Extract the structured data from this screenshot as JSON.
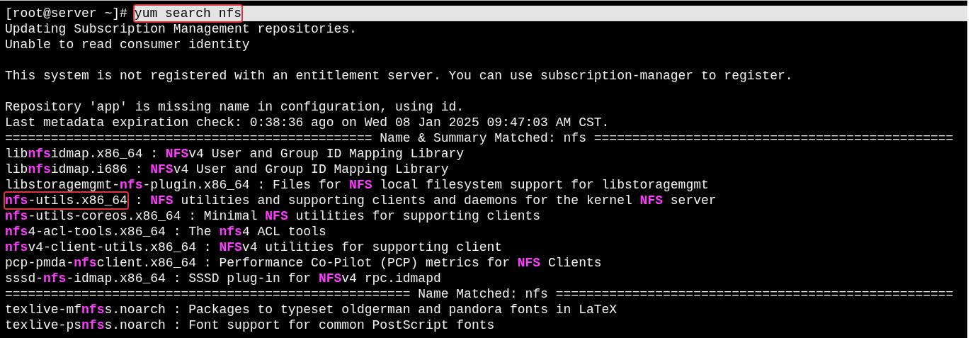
{
  "terminal": {
    "lines": [
      {
        "kind": "prompt",
        "prompt": "[root@server ~]#",
        "command": "yum search nfs",
        "boxed": true
      },
      {
        "kind": "text",
        "text": "Updating Subscription Management repositories."
      },
      {
        "kind": "text",
        "text": "Unable to read consumer identity"
      },
      {
        "kind": "blank"
      },
      {
        "kind": "text",
        "text": "This system is not registered with an entitlement server. You can use subscription-manager to register."
      },
      {
        "kind": "blank"
      },
      {
        "kind": "text",
        "text": "Repository 'app' is missing name in configuration, using id."
      },
      {
        "kind": "text",
        "text": "Last metadata expiration check: 0:38:36 ago on Wed 08 Jan 2025 09:47:03 AM CST."
      },
      {
        "kind": "text",
        "text": "================================================ Name & Summary Matched: nfs ==============================================="
      },
      {
        "kind": "package",
        "name": "lib**nfs**idmap.x86_64",
        "summary": " : **NFS**v4 User and Group ID Mapping Library",
        "boxed": false
      },
      {
        "kind": "package",
        "name": "lib**nfs**idmap.i686",
        "summary": " : **NFS**v4 User and Group ID Mapping Library",
        "boxed": false
      },
      {
        "kind": "package",
        "name": "libstoragemgmt-**nfs**-plugin.x86_64",
        "summary": " : Files for **NFS** local filesystem support for libstoragemgmt",
        "boxed": false
      },
      {
        "kind": "package",
        "name": "**nfs**-utils.x86_64",
        "summary": " : **NFS** utilities and supporting clients and daemons for the kernel **NFS** server",
        "boxed": true
      },
      {
        "kind": "package",
        "name": "**nfs**-utils-coreos.x86_64",
        "summary": " : Minimal **NFS** utilities for supporting clients",
        "boxed": false
      },
      {
        "kind": "package",
        "name": "**nfs**4-acl-tools.x86_64",
        "summary": " : The **nfs**4 ACL tools",
        "boxed": false
      },
      {
        "kind": "package",
        "name": "**nfs**v4-client-utils.x86_64",
        "summary": " : **NFS**v4 utilities for supporting client",
        "boxed": false
      },
      {
        "kind": "package",
        "name": "pcp-pmda-**nfs**client.x86_64",
        "summary": " : Performance Co-Pilot (PCP) metrics for **NFS** Clients",
        "boxed": false
      },
      {
        "kind": "package",
        "name": "sssd-**nfs**-idmap.x86_64",
        "summary": " : SSSD plug-in for **NFS**v4 rpc.idmapd",
        "boxed": false
      },
      {
        "kind": "text",
        "text": "===================================================== Name Matched: nfs ===================================================="
      },
      {
        "kind": "package",
        "name": "texlive-mf**nfs**s.noarch",
        "summary": " : Packages to typeset oldgerman and pandora fonts in LaTeX",
        "boxed": false
      },
      {
        "kind": "package",
        "name": "texlive-ps**nfs**s.noarch",
        "summary": " : Font support for common PostScript fonts",
        "boxed": false
      }
    ]
  }
}
